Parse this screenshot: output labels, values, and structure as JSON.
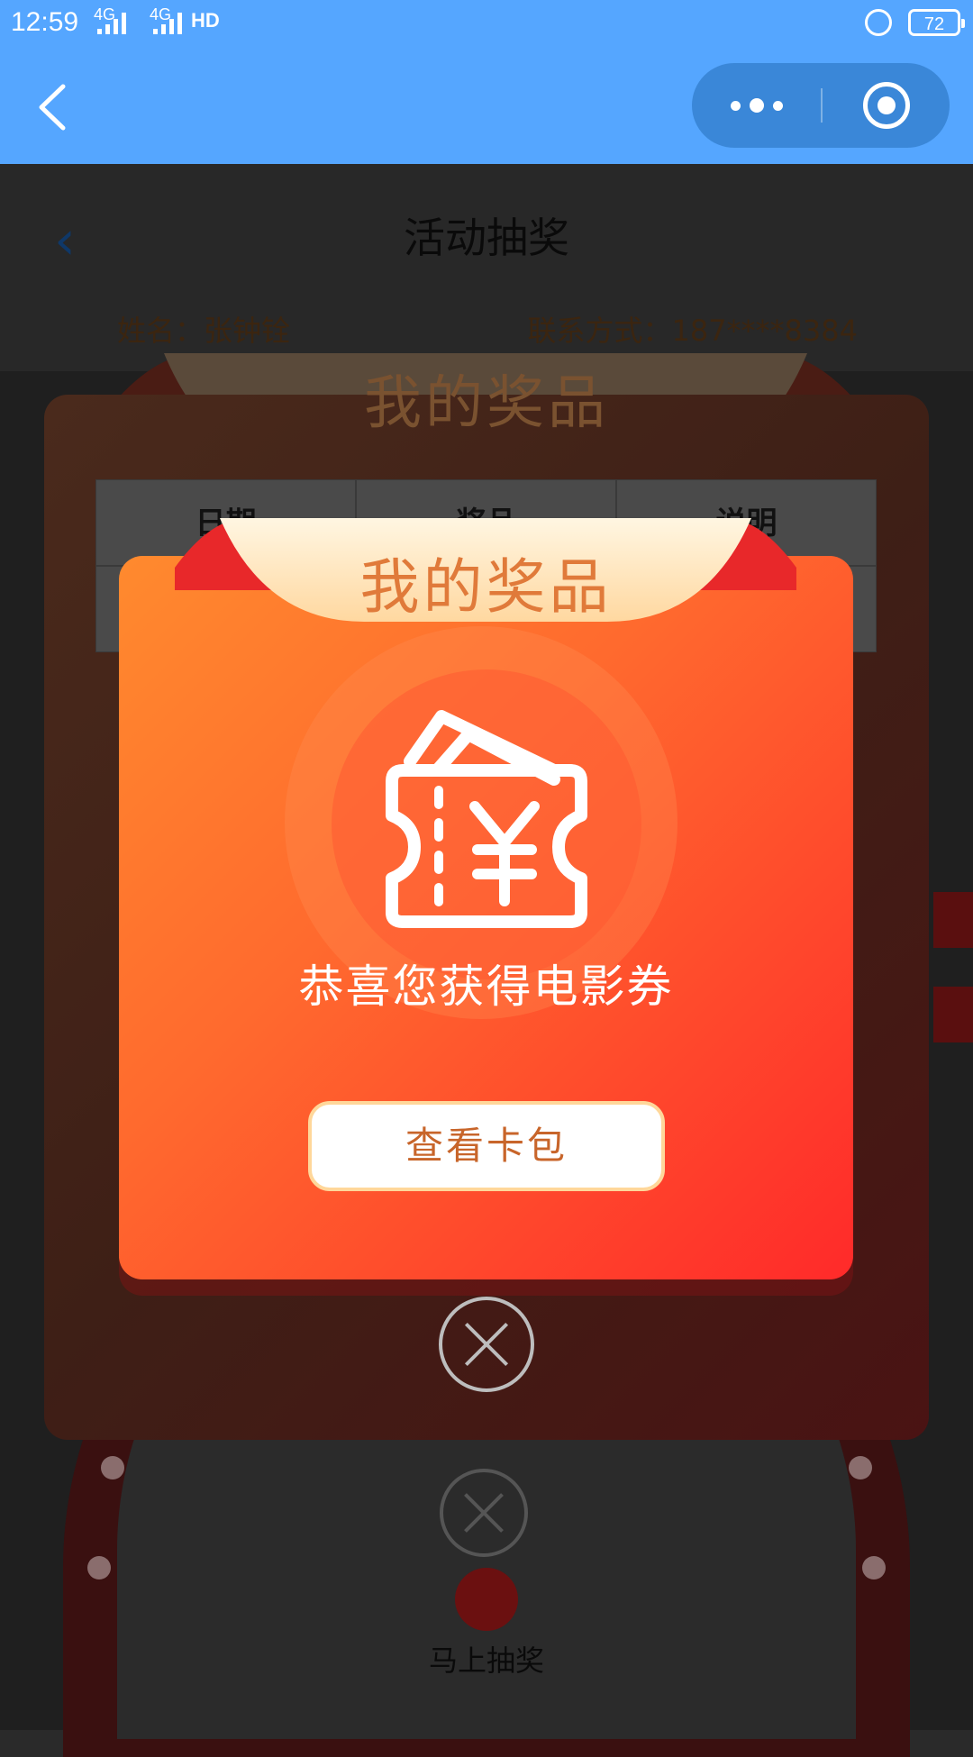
{
  "status_bar": {
    "time": "12:59",
    "net1": "4G",
    "net2": "4G",
    "hd": "HD",
    "battery": "72"
  },
  "nav": {
    "back_icon": "chevron-left-icon",
    "more_icon": "more-dots-icon",
    "close_icon": "target-circle-icon"
  },
  "background_page": {
    "title": "活动抽奖",
    "name": "姓名：张钟铨",
    "contact": "联系方式：187****8384",
    "wheel_label": "马上抽奖"
  },
  "prize_list": {
    "title": "我的奖品",
    "columns": [
      "日期",
      "奖品",
      "说明"
    ]
  },
  "modal": {
    "title": "我的奖品",
    "icon": "coupon-yuan-icon",
    "message": "恭喜您获得电影券",
    "button_label": "查看卡包",
    "close_icon": "close-circle-icon"
  },
  "colors": {
    "nav_blue": "#55a6ff",
    "card_orange": "#ff8a2e",
    "card_red": "#ff2a2a",
    "button_text": "#c8652a"
  }
}
